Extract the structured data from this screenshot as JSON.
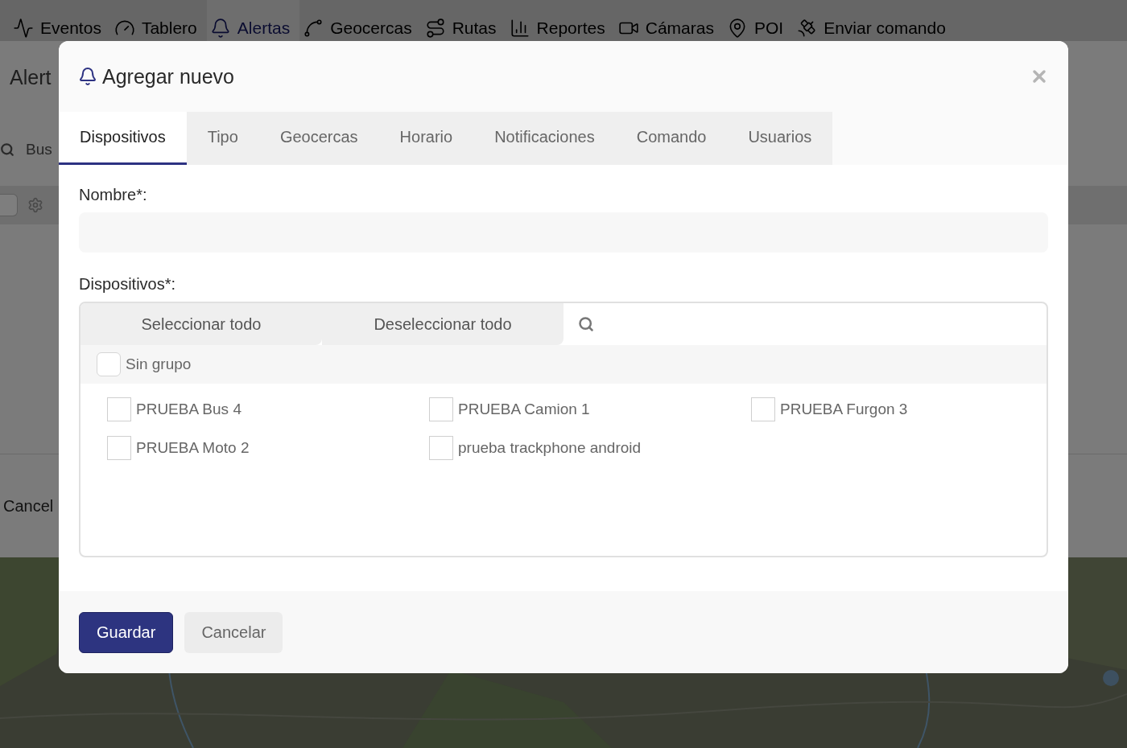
{
  "nav": {
    "items": [
      {
        "label": "Eventos",
        "selected": false
      },
      {
        "label": "Tablero",
        "selected": false
      },
      {
        "label": "Alertas",
        "selected": true
      },
      {
        "label": "Geocercas",
        "selected": false
      },
      {
        "label": "Rutas",
        "selected": false
      },
      {
        "label": "Reportes",
        "selected": false
      },
      {
        "label": "Cámaras",
        "selected": false
      },
      {
        "label": "POI",
        "selected": false
      },
      {
        "label": "Enviar comando",
        "selected": false
      }
    ]
  },
  "background_panel": {
    "title": "Alert",
    "search_placeholder": "Bus",
    "footer_button": "Cancel",
    "row_checkbox": {
      "checked": false
    }
  },
  "modal": {
    "title": "Agregar nuevo",
    "tabs": [
      {
        "label": "Dispositivos",
        "selected": true
      },
      {
        "label": "Tipo",
        "selected": false
      },
      {
        "label": "Geocercas",
        "selected": false
      },
      {
        "label": "Horario",
        "selected": false
      },
      {
        "label": "Notificaciones",
        "selected": false
      },
      {
        "label": "Comando",
        "selected": false
      },
      {
        "label": "Usuarios",
        "selected": false
      }
    ],
    "name_label": "Nombre*:",
    "devices_label": "Dispositivos*:",
    "select_all": "Seleccionar todo",
    "deselect_all": "Deseleccionar todo",
    "group": {
      "label": "Sin grupo",
      "checked": false,
      "devices": [
        {
          "label": "PRUEBA Bus 4",
          "checked": false
        },
        {
          "label": "PRUEBA Camion 1",
          "checked": false
        },
        {
          "label": "PRUEBA Furgon 3",
          "checked": false
        },
        {
          "label": "PRUEBA Moto 2",
          "checked": false
        },
        {
          "label": "prueba trackphone android",
          "checked": false
        }
      ]
    },
    "buttons": {
      "save": "Guardar",
      "cancel": "Cancelar"
    }
  }
}
